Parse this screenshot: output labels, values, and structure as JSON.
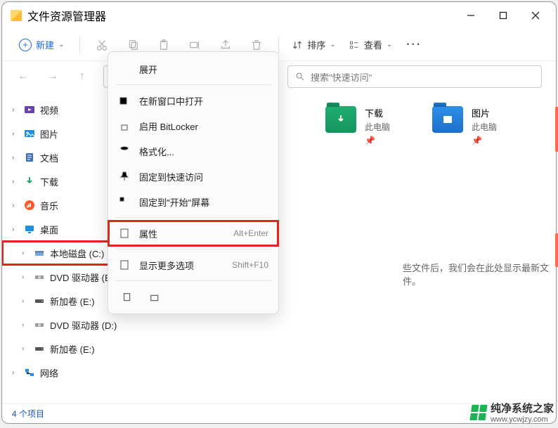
{
  "title": "文件资源管理器",
  "toolbar": {
    "new": "新建",
    "sort": "排序",
    "view": "查看"
  },
  "search_placeholder": "搜索\"快速访问\"",
  "sidebar": [
    {
      "label": "视频",
      "icon": "video",
      "color": "#6b3fb5"
    },
    {
      "label": "图片",
      "icon": "image",
      "color": "#1f8fe0"
    },
    {
      "label": "文档",
      "icon": "doc",
      "color": "#3a6fb5"
    },
    {
      "label": "下载",
      "icon": "download",
      "color": "#2aa866"
    },
    {
      "label": "音乐",
      "icon": "music",
      "color": "#ff5a2a"
    },
    {
      "label": "桌面",
      "icon": "desktop",
      "color": "#1f8fe0"
    },
    {
      "label": "本地磁盘 (C:)",
      "icon": "disk",
      "highlight": true,
      "indent": true
    },
    {
      "label": "DVD 驱动器 (E:)",
      "icon": "dvd",
      "indent": true
    },
    {
      "label": "新加卷 (E:)",
      "icon": "disk2",
      "indent": true
    },
    {
      "label": "DVD 驱动器 (D:)",
      "icon": "dvd",
      "indent": true
    },
    {
      "label": "新加卷 (E:)",
      "icon": "disk2",
      "indent": true
    },
    {
      "label": "网络",
      "icon": "network",
      "color": "#1f8fe0"
    }
  ],
  "context_menu": {
    "expand": "展开",
    "items": [
      {
        "label": "在新窗口中打开",
        "icon": "newwin"
      },
      {
        "label": "启用 BitLocker",
        "icon": "lock"
      },
      {
        "label": "格式化...",
        "icon": "format"
      },
      {
        "label": "固定到快速访问",
        "icon": "pin"
      },
      {
        "label": "固定到\"开始\"屏幕",
        "icon": "pinstart"
      },
      {
        "label": "属性",
        "icon": "props",
        "hint": "Alt+Enter",
        "highlight": true
      },
      {
        "label": "显示更多选项",
        "icon": "more",
        "hint": "Shift+F10"
      }
    ]
  },
  "cards": [
    {
      "title": "下载",
      "sub": "此电脑",
      "color": "green",
      "inner": "↓"
    },
    {
      "title": "图片",
      "sub": "此电脑",
      "color": "blue",
      "inner": "▲"
    }
  ],
  "empty_hint": "些文件后，我们会在此处显示最新文件。",
  "status": "4 个项目",
  "watermark": {
    "name": "纯净系统之家",
    "url": "www.ycwjzy.com"
  }
}
